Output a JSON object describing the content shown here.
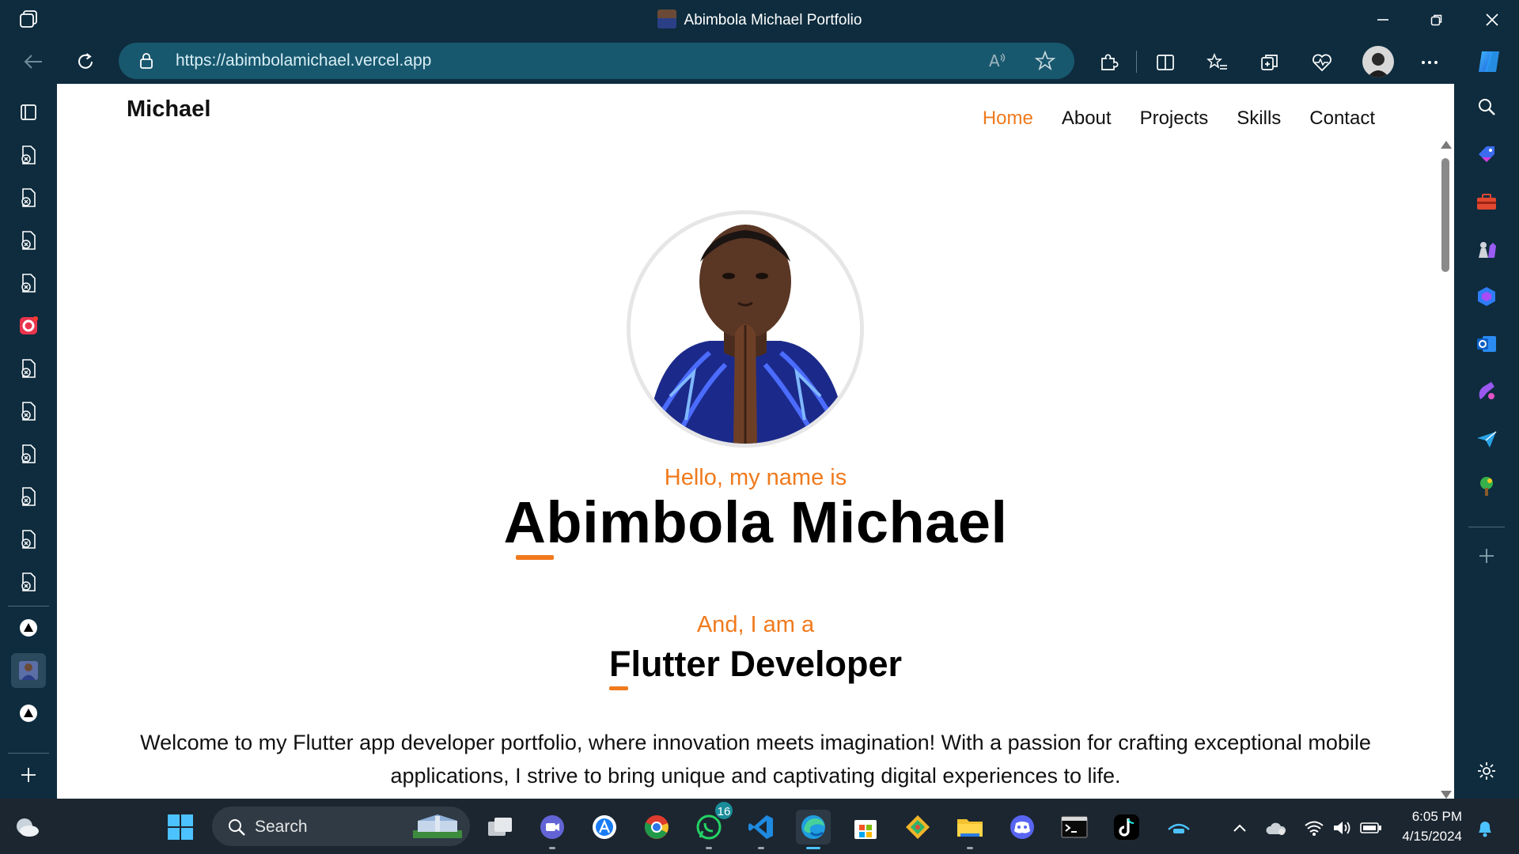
{
  "window": {
    "title": "Abimbola Michael Portfolio"
  },
  "browser": {
    "url": "https://abimbolamichael.vercel.app"
  },
  "site": {
    "brand": "Michael",
    "nav": [
      {
        "label": "Home",
        "active": true
      },
      {
        "label": "About",
        "active": false
      },
      {
        "label": "Projects",
        "active": false
      },
      {
        "label": "Skills",
        "active": false
      },
      {
        "label": "Contact",
        "active": false
      }
    ],
    "hero": {
      "greeting": "Hello, my name is",
      "name": "Abimbola Michael",
      "role_intro": "And, I am a",
      "role": "Flutter Developer",
      "intro": "Welcome to my Flutter app developer portfolio, where innovation meets imagination! With a passion for crafting exceptional mobile applications, I strive to bring unique and captivating digital experiences to life."
    },
    "accent_color": "#f07a1d"
  },
  "taskbar": {
    "search_placeholder": "Search",
    "whatsapp_badge": "16",
    "time": "6:05 PM",
    "date": "4/15/2024"
  },
  "colors": {
    "chrome": "#0e2c3e",
    "urlbar": "#18586e",
    "taskbar": "#1c2630"
  }
}
